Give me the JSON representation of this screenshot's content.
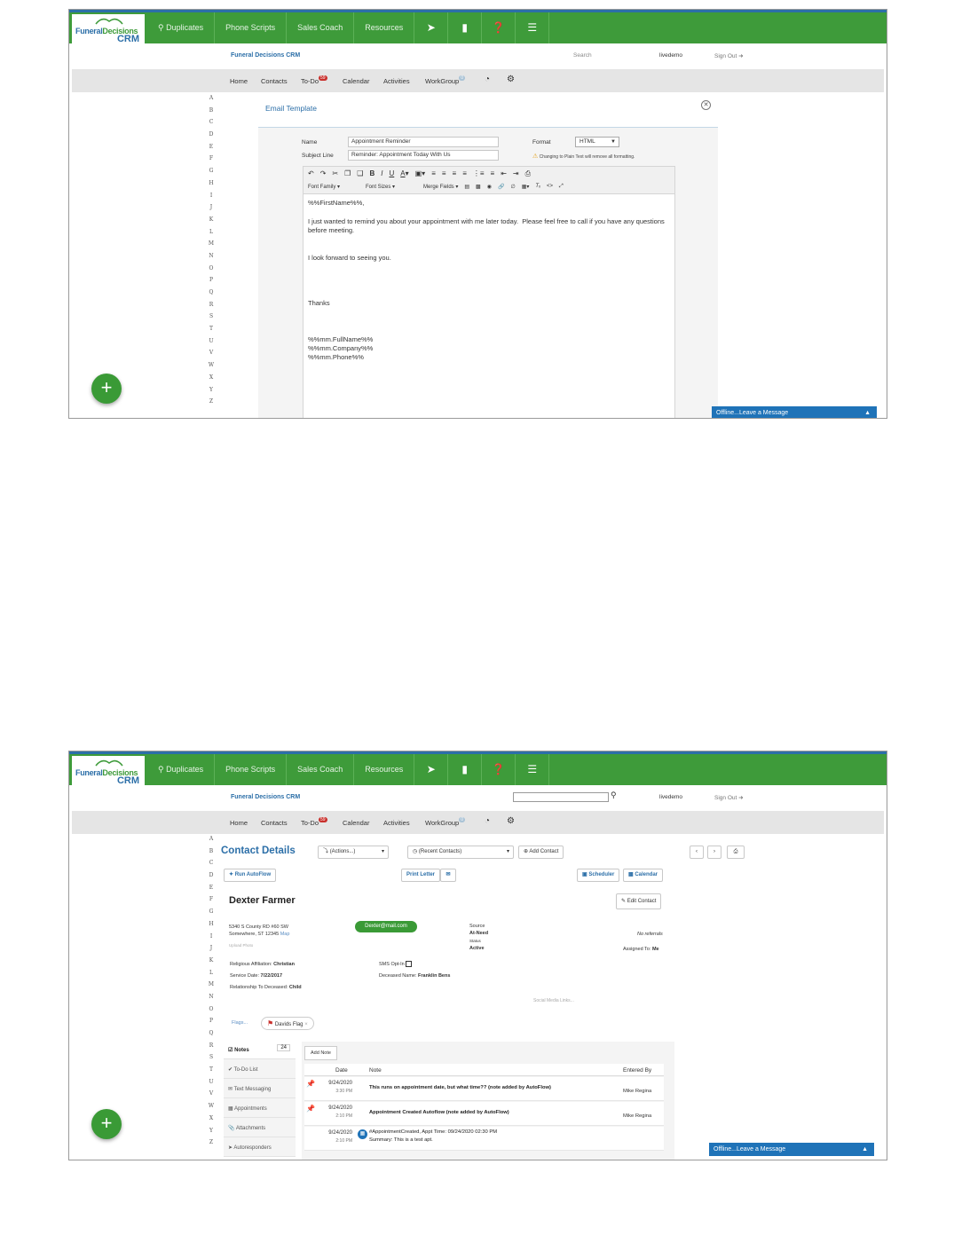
{
  "header": {
    "logo_text": "FuneralDecisions CRM",
    "menu": [
      "Duplicates",
      "Phone Scripts",
      "Sales Coach",
      "Resources"
    ],
    "menu_icons": [
      "rocket-icon",
      "book-icon",
      "help-icon",
      "hamburger-icon"
    ],
    "crm_name": "Funeral Decisions CRM",
    "search_label": "Search",
    "user": "livedemo",
    "sign_out": "Sign Out"
  },
  "nav": {
    "home": "Home",
    "contacts": "Contacts",
    "todo": "To-Do",
    "todo_count": "59",
    "calendar": "Calendar",
    "activities": "Activities",
    "workgroup": "WorkGroup",
    "workgroup_count": "0"
  },
  "alphabet": [
    "A",
    "B",
    "C",
    "D",
    "E",
    "F",
    "G",
    "H",
    "I",
    "J",
    "K",
    "L",
    "M",
    "N",
    "O",
    "P",
    "Q",
    "R",
    "S",
    "T",
    "U",
    "V",
    "W",
    "X",
    "Y",
    "Z"
  ],
  "chat_label": "Offline...Leave a Message",
  "email_template": {
    "title": "Email Template",
    "name_label": "Name",
    "name_value": "Appointment Reminder",
    "subject_label": "Subject Line",
    "subject_value": "Reminder: Appointment Today With Us",
    "format_label": "Format",
    "format_value": "HTML",
    "warning": "Changing to Plain Text will remove all formatting.",
    "font_family": "Font Family",
    "font_sizes": "Font Sizes",
    "merge_fields": "Merge Fields",
    "body": [
      "%%FirstName%%,",
      "I just wanted to remind you about your appointment with me later today.  Please feel free to call if you have any questions before meeting.",
      "I look forward to seeing you.",
      "Thanks",
      "%%mm.FullName%%\n%%mm.Company%%\n%%mm.Phone%%"
    ]
  },
  "contact": {
    "title": "Contact Details",
    "actions": "(Actions...)",
    "recent": "(Recent Contacts)",
    "add_contact": "Add Contact",
    "run_autoflow": "Run AutoFlow",
    "print_letter": "Print Letter",
    "scheduler": "Scheduler",
    "calendar": "Calendar",
    "edit_contact": "Edit Contact",
    "name": "Dexter Farmer",
    "address1": "5340 S County RD #60 SW",
    "address2": "Somewhere, ST 12345",
    "map": "Map",
    "upload_photo": "Upload Photo",
    "email": "Dexter@mail.com",
    "source_label": "Source",
    "source": "At-Need",
    "status_label": "Status",
    "status": "Active",
    "referrals": "No referrals",
    "assigned_label": "Assigned To:",
    "assigned": "Me",
    "religious_label": "Religious Affiliation:",
    "religious": "Christian",
    "service_label": "Service Date:",
    "service": "7/22/2017",
    "relationship_label": "Relationship To Deceased:",
    "relationship": "Child",
    "sms_label": "SMS Opt-In",
    "deceased_label": "Deceased Name:",
    "deceased": "Franklin Bens",
    "social": "Social Media Links...",
    "flags": "Flags...",
    "flag_name": "Davids Flag",
    "tabs": [
      "Notes",
      "To-Do List",
      "Text Messaging",
      "Appointments",
      "Attachments",
      "Autoresponders"
    ],
    "notes_count": "24",
    "add_note": "Add Note",
    "note_headers": [
      "Date",
      "Note",
      "Entered By"
    ],
    "notes": [
      {
        "date": "9/24/2020",
        "time": "3:30 PM",
        "text": "This runs on appointment date, but what time?? (note added by AutoFlow)",
        "by": "Mike Regina"
      },
      {
        "date": "9/24/2020",
        "time": "2:10 PM",
        "text": "Appointment Created Autoflow (note added by AutoFlow)",
        "by": "Mike Regina"
      },
      {
        "date": "9/24/2020",
        "time": "2:10 PM",
        "text": "#AppointmentCreated, Appt Time: 09/24/2020 02:30 PM",
        "text2": "Summary: This is a test apt.",
        "by": ""
      }
    ]
  }
}
